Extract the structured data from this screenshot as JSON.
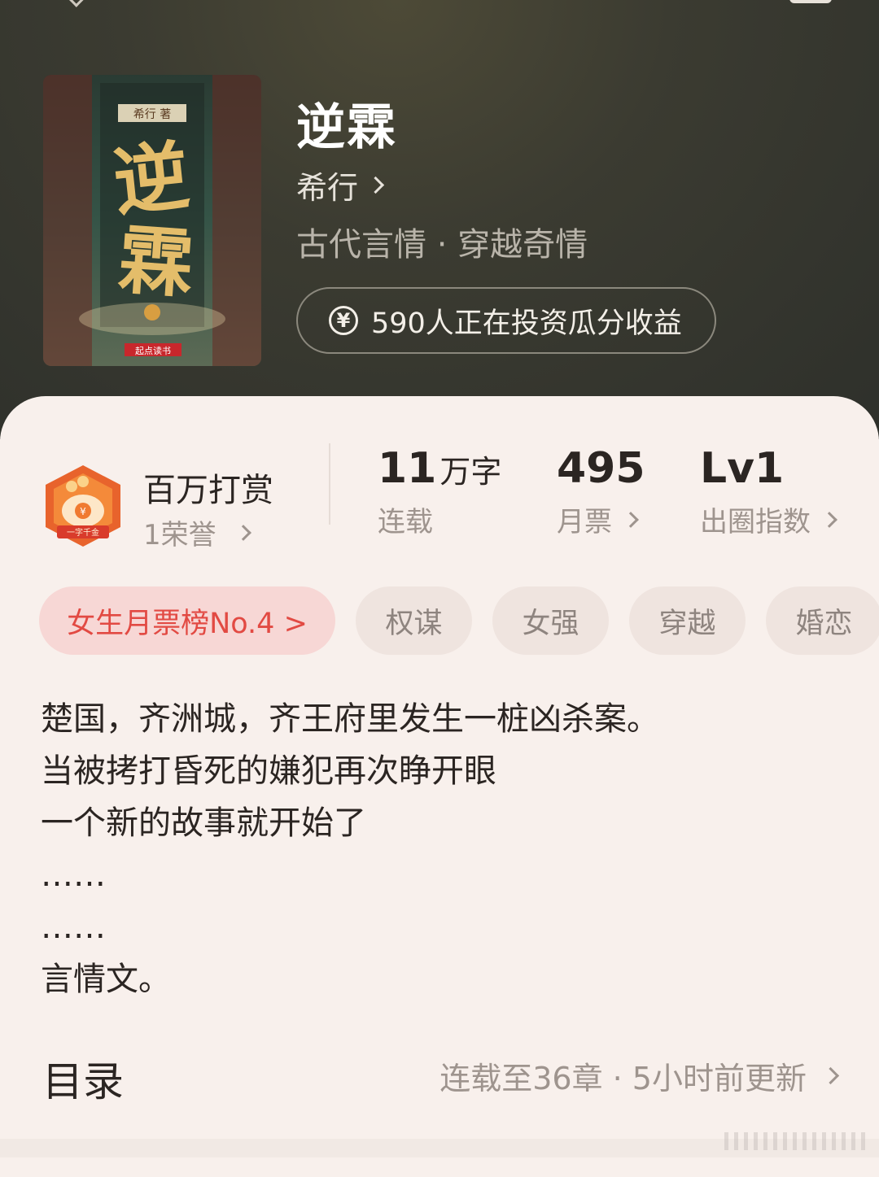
{
  "book": {
    "title": "逆霖",
    "author": "希行",
    "genre": "古代言情 · 穿越奇情",
    "invest_text": "590人正在投资瓜分收益",
    "cover": {
      "author_tag": "希行 著",
      "title_art": "逆霖",
      "publisher": "起点读书"
    }
  },
  "reward": {
    "title": "百万打赏",
    "subtitle": "1荣誉",
    "badge_text": "一字千金"
  },
  "stats": [
    {
      "value": "11",
      "unit": "万字",
      "label": "连载"
    },
    {
      "value": "495",
      "unit": "",
      "label": "月票"
    },
    {
      "value": "Lv1",
      "unit": "",
      "label": "出圈指数"
    }
  ],
  "tags": {
    "rank": "女生月票榜No.4 >",
    "items": [
      "权谋",
      "女强",
      "穿越",
      "婚恋"
    ]
  },
  "description": [
    "楚国，齐洲城，齐王府里发生一桩凶杀案。",
    "当被拷打昏死的嫌犯再次睁开眼",
    "一个新的故事就开始了",
    "……",
    "……",
    "言情文。"
  ],
  "toc": {
    "title": "目录",
    "info": "连载至36章 · 5小时前更新"
  },
  "colors": {
    "rank_tag_bg": "#f7d7d5",
    "rank_tag_text": "#e24a43",
    "header_bg": "#3b3b31",
    "card_bg": "#f8f0ec"
  }
}
